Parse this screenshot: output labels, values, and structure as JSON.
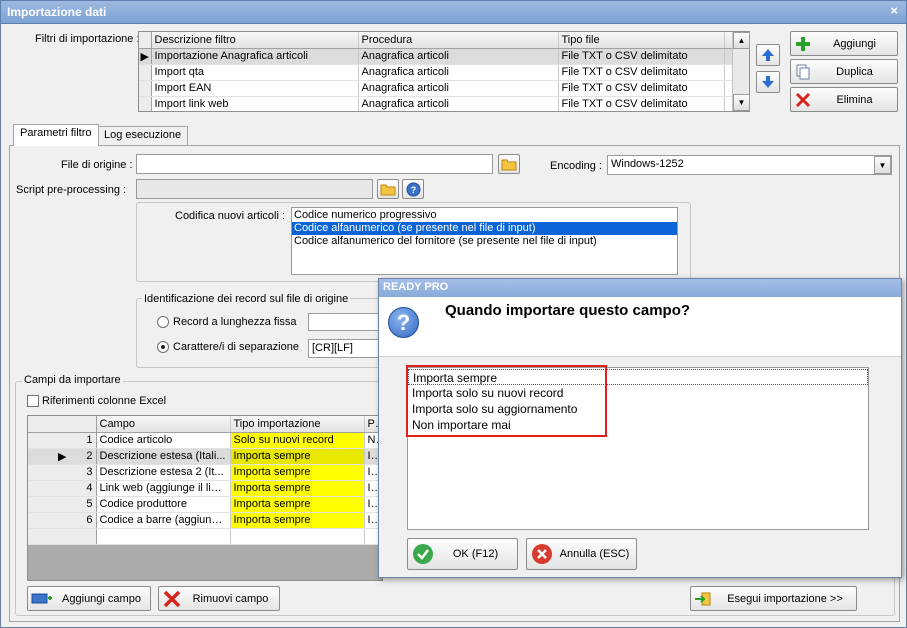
{
  "window": {
    "title": "Importazione dati",
    "close": "×"
  },
  "filters": {
    "label": "Filtri di importazione :",
    "columns": [
      "Descrizione filtro",
      "Procedura",
      "Tipo file"
    ],
    "rows": [
      [
        "Importazione Anagrafica articoli",
        "Anagrafica articoli",
        "File TXT o CSV delimitato"
      ],
      [
        "Import qta",
        "Anagrafica articoli",
        "File TXT o CSV delimitato"
      ],
      [
        "Import EAN",
        "Anagrafica articoli",
        "File TXT o CSV delimitato"
      ],
      [
        "Import link web",
        "Anagrafica articoli",
        "File TXT o CSV delimitato"
      ]
    ],
    "add_label": "Aggiungi",
    "duplicate_label": "Duplica",
    "delete_label": "Elimina"
  },
  "tabs": [
    {
      "label": "Parametri filtro"
    },
    {
      "label": "Log esecuzione"
    }
  ],
  "params": {
    "file_label": "File di origine :",
    "file_value": "",
    "encoding_label": "Encoding :",
    "encoding_value": "Windows-1252",
    "script_label": "Script pre-processing :",
    "script_value": "",
    "coding_label": "Codifica nuovi articoli :",
    "coding_options": [
      "Codice numerico progressivo",
      "Codice alfanumerico (se presente nel file di input)",
      "Codice alfanumerico del fornitore (se presente nel file di input)"
    ],
    "ident_label": "Identificazione dei record sul file di origine",
    "fixed_label": "Record a lunghezza fissa",
    "fixed_value": "",
    "sep_label": "Carattere/i di separazione",
    "sep_value": "[CR][LF]"
  },
  "fields": {
    "group_label": "Campi da importare",
    "excel_label": "Riferimenti colonne Excel",
    "columns": [
      "Campo",
      "Tipo importazione",
      "Pa"
    ],
    "rows": [
      {
        "n": "1",
        "campo": "Codice articolo",
        "tipo": "Solo su nuovi record",
        "pa": "No"
      },
      {
        "n": "2",
        "campo": "Descrizione estesa (Itali...",
        "tipo": "Importa sempre",
        "pa": "Im"
      },
      {
        "n": "3",
        "campo": "Descrizione estesa 2 (It...",
        "tipo": "Importa sempre",
        "pa": "Im"
      },
      {
        "n": "4",
        "campo": "Link web (aggiunge il link...",
        "tipo": "Importa sempre",
        "pa": "Im"
      },
      {
        "n": "5",
        "campo": "Codice produttore",
        "tipo": "Importa sempre",
        "pa": "Im"
      },
      {
        "n": "6",
        "campo": "Codice a barre (aggiung...",
        "tipo": "Importa sempre",
        "pa": "Im"
      }
    ],
    "add_label": "Aggiungi campo",
    "remove_label": "Rimuovi campo",
    "run_label": "Esegui importazione >>"
  },
  "dialog": {
    "title": "READY PRO",
    "question": "Quando importare questo campo?",
    "options": [
      "Importa sempre",
      "Importa solo su nuovi record",
      "Importa solo su aggiornamento",
      "Non importare mai"
    ],
    "ok_label": "OK (F12)",
    "cancel_label": "Annulla (ESC)"
  }
}
